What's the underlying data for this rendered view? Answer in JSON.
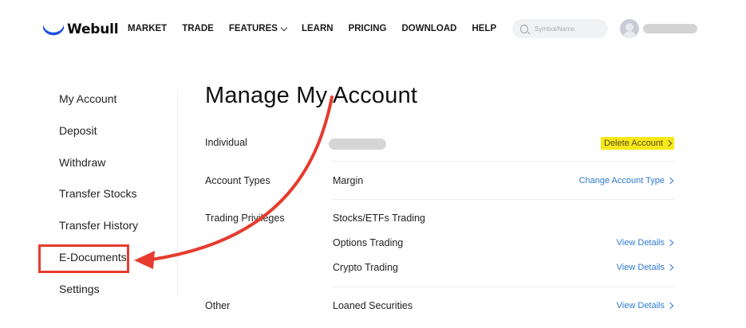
{
  "brand": {
    "name": "Webull",
    "accent": "#1b4fe0"
  },
  "nav": [
    {
      "label": "MARKET"
    },
    {
      "label": "TRADE"
    },
    {
      "label": "FEATURES",
      "has_dropdown": true
    },
    {
      "label": "LEARN"
    },
    {
      "label": "PRICING"
    },
    {
      "label": "DOWNLOAD"
    },
    {
      "label": "HELP"
    }
  ],
  "search": {
    "placeholder": "Symbol/Name",
    "icon": "search-icon"
  },
  "sidebar": {
    "items": [
      {
        "label": "My Account"
      },
      {
        "label": "Deposit"
      },
      {
        "label": "Withdraw"
      },
      {
        "label": "Transfer Stocks"
      },
      {
        "label": "Transfer History"
      },
      {
        "label": "E-Documents",
        "highlighted": true
      },
      {
        "label": "Settings"
      }
    ]
  },
  "main": {
    "title": "Manage My Account",
    "rows": {
      "individual": {
        "label": "Individual",
        "action": "Delete Account"
      },
      "account_types": {
        "label": "Account Types",
        "value": "Margin",
        "action": "Change Account Type"
      },
      "trading_privileges": {
        "label": "Trading Privileges",
        "items": [
          {
            "value": "Stocks/ETFs Trading"
          },
          {
            "value": "Options Trading",
            "action": "View Details"
          },
          {
            "value": "Crypto Trading",
            "action": "View Details"
          }
        ]
      },
      "other": {
        "label": "Other",
        "value": "Loaned Securities",
        "action": "View Details"
      }
    }
  },
  "colors": {
    "link": "#2f7bd0",
    "highlight": "#f7e81a",
    "annotation_red": "#e63b2e"
  }
}
